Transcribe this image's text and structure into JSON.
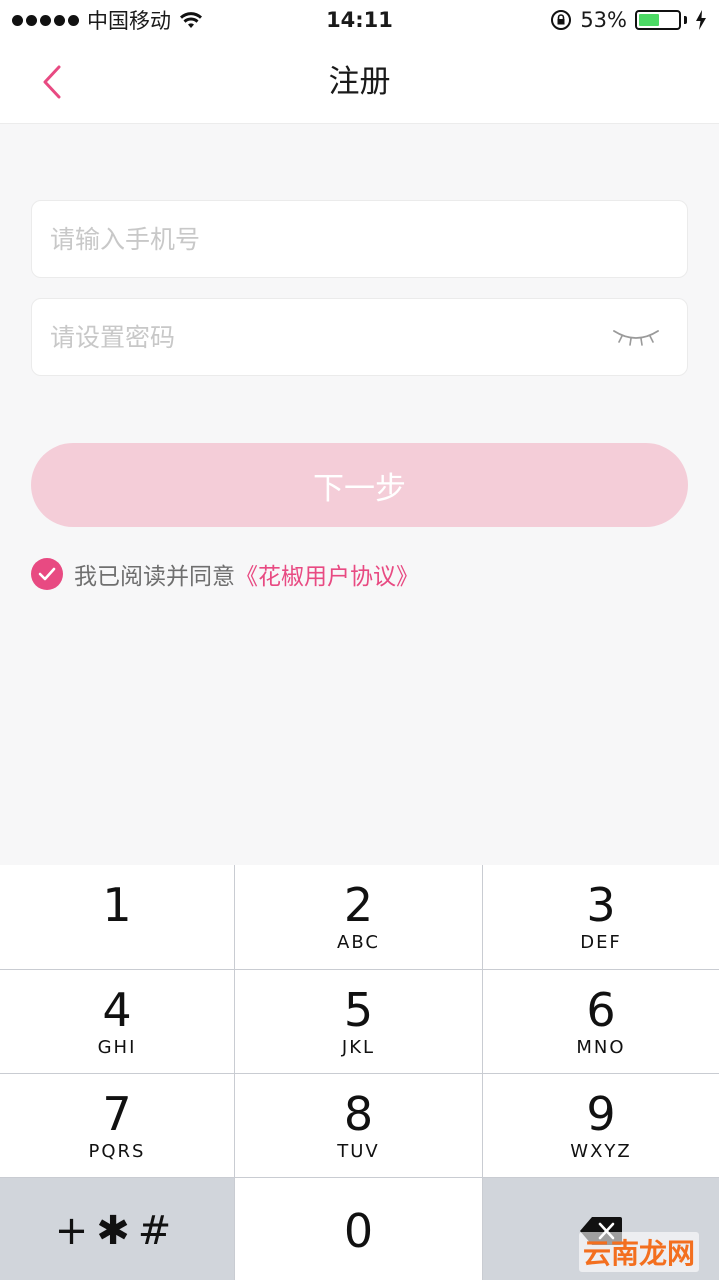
{
  "status_bar": {
    "carrier": "中国移动",
    "time": "14:11",
    "battery_percent": "53%",
    "battery_level": 0.53,
    "icons": [
      "signal-dots-icon",
      "wifi-icon",
      "rotation-lock-icon",
      "battery-icon",
      "charging-bolt-icon"
    ]
  },
  "nav": {
    "title": "注册",
    "back_icon": "chevron-left-icon"
  },
  "form": {
    "phone_placeholder": "请输入手机号",
    "phone_value": "",
    "password_placeholder": "请设置密码",
    "password_value": "",
    "eye_icon": "eye-closed-icon",
    "next_label": "下一步"
  },
  "agreement": {
    "checked": true,
    "text": "我已阅读并同意",
    "link": "《花椒用户协议》"
  },
  "keypad": {
    "keys": [
      {
        "digit": "1",
        "letters": ""
      },
      {
        "digit": "2",
        "letters": "ABC"
      },
      {
        "digit": "3",
        "letters": "DEF"
      },
      {
        "digit": "4",
        "letters": "GHI"
      },
      {
        "digit": "5",
        "letters": "JKL"
      },
      {
        "digit": "6",
        "letters": "MNO"
      },
      {
        "digit": "7",
        "letters": "PQRS"
      },
      {
        "digit": "8",
        "letters": "TUV"
      },
      {
        "digit": "9",
        "letters": "WXYZ"
      }
    ],
    "symbols": "+✱#",
    "zero": "0",
    "delete_icon": "backspace-icon"
  },
  "watermark": "云南龙网",
  "colors": {
    "accent": "#e84a82",
    "button_disabled": "#f4cdd8",
    "background": "#f7f7f8"
  }
}
